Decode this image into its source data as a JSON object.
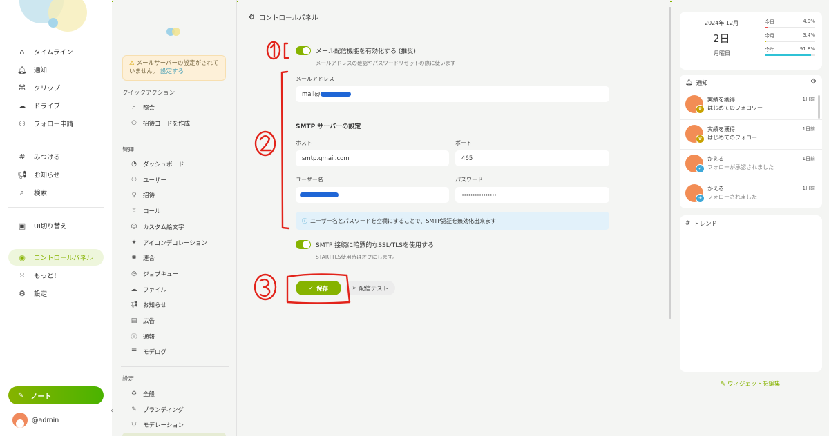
{
  "nav": {
    "items": [
      {
        "label": "タイムライン",
        "icon": "home-icon",
        "glyph": "⌂"
      },
      {
        "label": "通知",
        "icon": "bell-icon",
        "glyph": "🔔︎"
      },
      {
        "label": "クリップ",
        "icon": "paperclip-icon",
        "glyph": "⌘"
      },
      {
        "label": "ドライブ",
        "icon": "cloud-icon",
        "glyph": "☁"
      },
      {
        "label": "フォロー申請",
        "icon": "user-plus-icon",
        "glyph": "⚇"
      },
      {
        "label": "みつける",
        "icon": "hashtag-icon",
        "glyph": "#"
      },
      {
        "label": "お知らせ",
        "icon": "megaphone-icon",
        "glyph": "📢︎"
      },
      {
        "label": "検索",
        "icon": "search-icon",
        "glyph": "⌕"
      },
      {
        "label": "UI切り替え",
        "icon": "device-icon",
        "glyph": "▣"
      },
      {
        "label": "コントロールパネル",
        "icon": "gauge-icon",
        "glyph": "◉"
      },
      {
        "label": "もっと！",
        "icon": "grid-icon",
        "glyph": "⁙"
      },
      {
        "label": "設定",
        "icon": "gear-icon",
        "glyph": "⚙"
      }
    ],
    "note_label": "ノート",
    "account": "@admin"
  },
  "admin": {
    "warning": {
      "text": "メールサーバーの設定がされていません。",
      "link": "設定する"
    },
    "quick_title": "クイックアクション",
    "quick": [
      {
        "label": "照会",
        "glyph": "⌕"
      },
      {
        "label": "招待コードを作成",
        "glyph": "⚇"
      }
    ],
    "manage_title": "管理",
    "manage": [
      {
        "label": "ダッシュボード",
        "glyph": "◔"
      },
      {
        "label": "ユーザー",
        "glyph": "⚇"
      },
      {
        "label": "招待",
        "glyph": "⚲"
      },
      {
        "label": "ロール",
        "glyph": "♖"
      },
      {
        "label": "カスタム絵文字",
        "glyph": "☺"
      },
      {
        "label": "アイコンデコレーション",
        "glyph": "✦"
      },
      {
        "label": "連合",
        "glyph": "✺"
      },
      {
        "label": "ジョブキュー",
        "glyph": "◷"
      },
      {
        "label": "ファイル",
        "glyph": "☁"
      },
      {
        "label": "お知らせ",
        "glyph": "📢︎"
      },
      {
        "label": "広告",
        "glyph": "▤"
      },
      {
        "label": "通報",
        "glyph": "ⓘ"
      },
      {
        "label": "モデログ",
        "glyph": "☰"
      }
    ],
    "settings_title": "設定",
    "settings": [
      {
        "label": "全般",
        "glyph": "⚙"
      },
      {
        "label": "ブランディング",
        "glyph": "✎"
      },
      {
        "label": "モデレーション",
        "glyph": "⛉"
      }
    ]
  },
  "main": {
    "title": "コントロールパネル",
    "email_enable": {
      "label": "メール配信機能を有効化する (推奨)",
      "sub": "メールアドレスの確認やパスワードリセットの際に使います"
    },
    "email_label": "メールアドレス",
    "email_value": "mail@",
    "smtp_title": "SMTP サーバーの設定",
    "host_label": "ホスト",
    "host_value": "smtp.gmail.com",
    "port_label": "ポート",
    "port_value": "465",
    "user_label": "ユーザー名",
    "password_label": "パスワード",
    "password_value": "••••••••••••••••",
    "info": "ユーザー名とパスワードを空欄にすることで、SMTP認証を無効化出来ます",
    "ssl": {
      "label": "SMTP 接続に暗黙的なSSL/TLSを使用する",
      "sub": "STARTTLS使用時はオフにします。"
    },
    "save_label": "保存",
    "test_label": "配信テスト"
  },
  "calendar": {
    "year_month": "2024年 12月",
    "day": "2日",
    "weekday": "月曜日",
    "rows": [
      {
        "label": "今日",
        "value": "4.9%",
        "fraction": 0.049,
        "color": "#e84c4c"
      },
      {
        "label": "今月",
        "value": "3.4%",
        "fraction": 0.034,
        "color": "#c9c400"
      },
      {
        "label": "今年",
        "value": "91.8%",
        "fraction": 0.918,
        "color": "#2fc2d6"
      }
    ]
  },
  "notifications": {
    "title": "通知",
    "items": [
      {
        "title": "実績を獲得",
        "sub": "はじめてのフォロワー",
        "time": "1日前",
        "badge": "♛",
        "badge_color": "#c8a200"
      },
      {
        "title": "実績を獲得",
        "sub": "はじめてのフォロー",
        "time": "1日前",
        "badge": "♛",
        "badge_color": "#c8a200"
      },
      {
        "title": "かえる",
        "sub": "フォローが承認されました",
        "time": "1日前",
        "badge": "✓",
        "badge_color": "#3ea8d8"
      },
      {
        "title": "かえる",
        "sub": "フォローされました",
        "time": "1日前",
        "badge": "+",
        "badge_color": "#3ea8d8"
      }
    ]
  },
  "trends": {
    "title": "トレンド"
  },
  "edit_widgets": "ウィジェットを編集",
  "annotations": [
    "1",
    "2",
    "3"
  ]
}
